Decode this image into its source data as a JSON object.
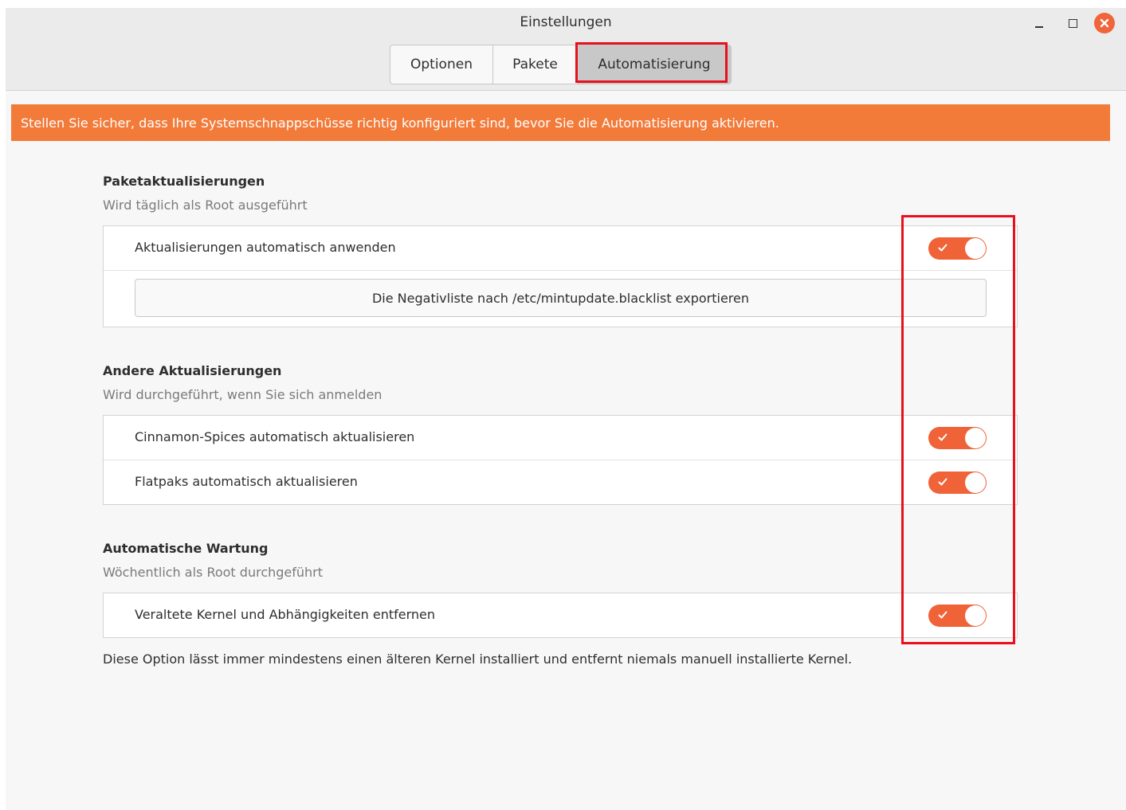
{
  "window": {
    "title": "Einstellungen"
  },
  "tabs": [
    {
      "label": "Optionen"
    },
    {
      "label": "Pakete"
    },
    {
      "label": "Automatisierung"
    }
  ],
  "banner": {
    "text": "Stellen Sie sicher, dass Ihre Systemschnappschüsse richtig konfiguriert sind, bevor Sie die Automatisierung aktivieren."
  },
  "sections": {
    "packages": {
      "title": "Paketaktualisierungen",
      "subtitle": "Wird täglich als Root ausgeführt",
      "auto_apply_label": "Aktualisierungen automatisch anwenden",
      "auto_apply_on": true,
      "export_button_label": "Die Negativliste nach /etc/mintupdate.blacklist exportieren"
    },
    "other": {
      "title": "Andere Aktualisierungen",
      "subtitle": "Wird durchgeführt, wenn Sie sich anmelden",
      "spices_label": "Cinnamon-Spices automatisch aktualisieren",
      "spices_on": true,
      "flatpaks_label": "Flatpaks automatisch aktualisieren",
      "flatpaks_on": true
    },
    "maintenance": {
      "title": "Automatische Wartung",
      "subtitle": "Wöchentlich als Root durchgeführt",
      "kernel_label": "Veraltete Kernel und Abhängigkeiten entfernen",
      "kernel_on": true,
      "note": "Diese Option lässt immer mindestens einen älteren Kernel installiert und entfernt niemals manuell installierte Kernel."
    }
  },
  "colors": {
    "accent": "#f06237",
    "banner": "#f27b3a",
    "highlight": "#e8101c"
  }
}
